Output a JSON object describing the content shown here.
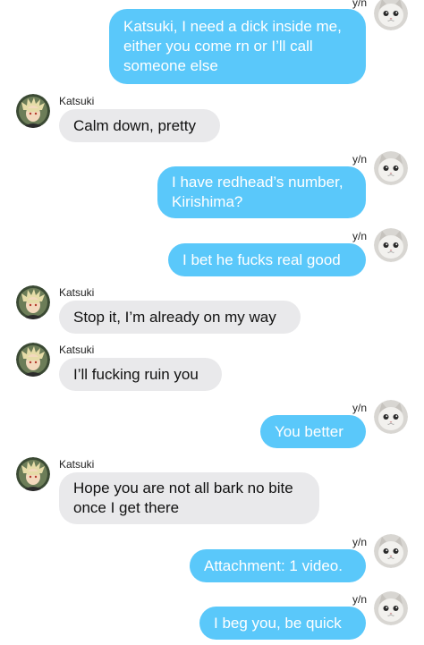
{
  "conversation": {
    "other_name": "Katsuki",
    "self_name": "y/n",
    "messages": [
      {
        "from": "self",
        "text": "Katsuki, I need a dick inside me,\neither  you come rn or I’ll call\nsomeone else"
      },
      {
        "from": "other",
        "text": "Calm down, pretty"
      },
      {
        "from": "self",
        "text": "I have redhead’s number,\nKirishima?"
      },
      {
        "from": "self",
        "text": "I bet he fucks real good"
      },
      {
        "from": "other",
        "text": "Stop it, I’m already on my way"
      },
      {
        "from": "other",
        "text": "I’ll fucking ruin you"
      },
      {
        "from": "self",
        "text": "You better"
      },
      {
        "from": "other",
        "text": "Hope you are not all bark no bite\nonce I get there"
      },
      {
        "from": "self",
        "text": "Attachment: 1 video."
      },
      {
        "from": "self",
        "text": "I beg you, be quick"
      }
    ]
  },
  "colors": {
    "outgoing_bubble": "#5ac8fa",
    "incoming_bubble": "#e9e9eb"
  },
  "icons": {
    "other_avatar": "anime-character-avatar-icon",
    "self_avatar": "cat-avatar-icon"
  }
}
